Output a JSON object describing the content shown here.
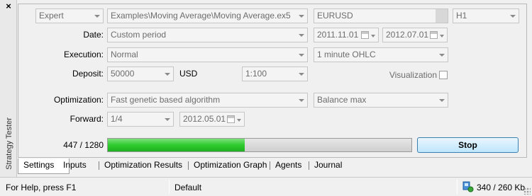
{
  "window": {
    "title": "Strategy Tester",
    "close_glyph": "×"
  },
  "settings": {
    "expert_type": "Expert",
    "expert_path": "Examples\\Moving Average\\Moving Average.ex5",
    "symbol": "EURUSD",
    "timeframe": "H1",
    "date_label": "Date:",
    "date_mode": "Custom period",
    "date_from": "2011.11.01",
    "date_to": "2012.07.01",
    "execution_label": "Execution:",
    "execution_mode": "Normal",
    "tick_model": "1 minute OHLC",
    "deposit_label": "Deposit:",
    "deposit_value": "50000",
    "currency": "USD",
    "leverage": "1:100",
    "visualization_label": "Visualization",
    "visualization_checked": false,
    "optimization_label": "Optimization:",
    "optimization_mode": "Fast genetic based algorithm",
    "optimization_criterion": "Balance max",
    "forward_label": "Forward:",
    "forward_value": "1/4",
    "forward_date": "2012.05.01"
  },
  "progress": {
    "text": "447 / 1280",
    "current": 447,
    "total": 1280,
    "bar_fraction": 0.45,
    "stop_label": "Stop"
  },
  "tabs": [
    {
      "label": "Settings",
      "active": true
    },
    {
      "label": "Inputs",
      "active": false
    },
    {
      "label": "Optimization Results",
      "active": false
    },
    {
      "label": "Optimization Graph",
      "active": false
    },
    {
      "label": "Agents",
      "active": false
    },
    {
      "label": "Journal",
      "active": false
    }
  ],
  "statusbar": {
    "help": "For Help, press F1",
    "profile": "Default",
    "traffic": "340 / 260 Kb"
  },
  "icons": {
    "calendar": "calendar-icon",
    "dropdown": "chevron-down-icon",
    "close": "close-icon",
    "network": "network-traffic-icon",
    "grip": "resize-grip-icon"
  },
  "colors": {
    "progress_green": "#2ecb2e",
    "stop_button": "#bee6fd",
    "disabled_text": "#6d6d6d"
  }
}
